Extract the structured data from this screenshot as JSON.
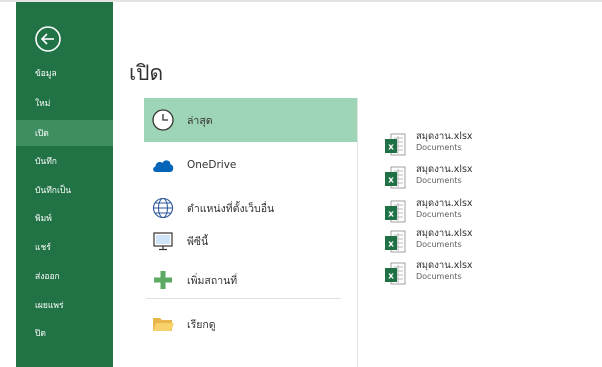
{
  "colors": {
    "sidebar_bg": "#217346",
    "sidebar_active": "#3e8e61",
    "selected_location": "#9fd5b7",
    "excel_green": "#1e7145"
  },
  "back_button": {
    "icon": "back-arrow-circle-icon"
  },
  "sidebar": {
    "items": [
      {
        "label": "ข้อมูล",
        "active": false
      },
      {
        "label": "ใหม่",
        "active": false
      },
      {
        "label": "เปิด",
        "active": true
      },
      {
        "label": "บันทึก",
        "active": false
      },
      {
        "label": "บันทึกเป็น",
        "active": false
      },
      {
        "label": "พิมพ์",
        "active": false
      },
      {
        "label": "แชร์",
        "active": false
      },
      {
        "label": "ส่งออก",
        "active": false
      },
      {
        "label": "เผยแพร่",
        "active": false
      },
      {
        "label": "ปิด",
        "active": false
      }
    ]
  },
  "main": {
    "title": "เปิด",
    "locations": [
      {
        "label": "ล่าสุด",
        "icon": "clock-icon",
        "selected": true
      },
      {
        "label": "OneDrive",
        "icon": "cloud-icon",
        "selected": false
      },
      {
        "label": "ตำแหน่งที่ตั้งเว็บอื่น",
        "icon": "globe-icon",
        "selected": false
      },
      {
        "label": "พีซีนี้",
        "icon": "computer-icon",
        "selected": false
      },
      {
        "label": "เพิ่มสถานที่",
        "icon": "plus-icon",
        "selected": false
      },
      {
        "label": "เรียกดู",
        "icon": "folder-icon",
        "selected": false
      }
    ],
    "recent_files": [
      {
        "name": "สมุดงาน.xlsx",
        "path": "Documents",
        "icon": "excel-file-icon"
      },
      {
        "name": "สมุดงาน.xlsx",
        "path": "Documents",
        "icon": "excel-file-icon"
      },
      {
        "name": "สมุดงาน.xlsx",
        "path": "Documents",
        "icon": "excel-file-icon"
      },
      {
        "name": "สมุดงาน.xlsx",
        "path": "Documents",
        "icon": "excel-file-icon"
      },
      {
        "name": "สมุดงาน.xlsx",
        "path": "Documents",
        "icon": "excel-file-icon"
      }
    ]
  }
}
